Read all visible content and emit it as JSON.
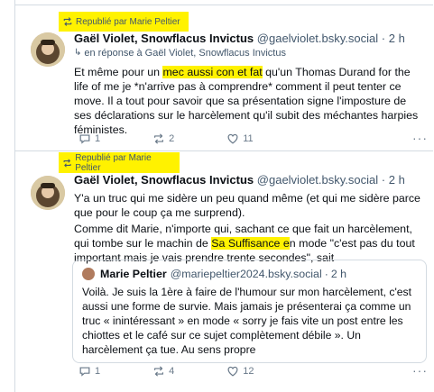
{
  "posts": [
    {
      "repost_label": "Republié par Marie Peltier",
      "author_name": "Gaël Violet, Snowflacus Invictus",
      "author_handle": "@gaelviolet.bsky.social",
      "separator": "·",
      "time": "2 h",
      "reply_to": "en réponse à Gaël Violet, Snowflacus Invictus",
      "text_parts": {
        "a": "Et même pour un ",
        "highlight": "mec aussi con et fat",
        "b": " qu'un Thomas Durand for the life of me je *n'arrive pas à comprendre* comment il peut tenter ce move. Il a tout pour savoir que sa présentation signe l'imposture de ses déclarations sur le harcèlement qu'il subit des méchantes harpies féministes."
      },
      "replies": "1",
      "reposts": "2",
      "likes": "11",
      "more": "···"
    },
    {
      "repost_label": "Republié par Marie Peltier",
      "author_name": "Gaël Violet, Snowflacus Invictus",
      "author_handle": "@gaelviolet.bsky.social",
      "separator": "·",
      "time": "2 h",
      "text_p1": "Y'a un truc qui me sidère un peu quand même (et qui me sidère parce que pour le coup ça me surprend).",
      "text_p2_parts": {
        "a": "Comme dit Marie, n'importe qui, sachant ce que fait un harcèlement, qui tombe sur le machin de ",
        "highlight": "Sa Suffisance e",
        "b": "n mode \"c'est pas du tout important mais je vais prendre trente secondes\", sait"
      },
      "quote": {
        "author_name": "Marie Peltier",
        "author_handle": "@mariepeltier2024.bsky.social",
        "separator": "·",
        "time": "2 h",
        "text": "Voilà. Je suis la 1ère  à faire de l'humour sur mon harcèlement, c'est aussi une forme de survie. Mais jamais je présenterai ça comme un truc « inintéressant » en mode « sorry je fais vite un post entre les chiottes et le café sur ce sujet complètement débile ». Un harcèlement ça tue. Au sens propre"
      },
      "replies": "1",
      "reposts": "4",
      "likes": "12",
      "more": "···"
    }
  ],
  "colors": {
    "highlight": "#fff200",
    "muted": "#42576c",
    "border": "#d4dbe2"
  },
  "icons": [
    "repost-icon",
    "reply-icon",
    "like-icon",
    "more-icon",
    "reply-arrow-icon"
  ]
}
